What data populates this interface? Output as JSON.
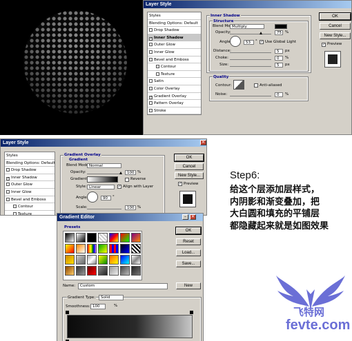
{
  "w1": {
    "title": "Layer Style",
    "styles": [
      {
        "label": "Styles",
        "cb": false,
        "checked": false,
        "sel": false,
        "ind": false
      },
      {
        "label": "Blending Options: Default",
        "cb": false,
        "checked": false,
        "sel": false,
        "ind": false
      },
      {
        "label": "Drop Shadow",
        "cb": true,
        "checked": false,
        "sel": false,
        "ind": false
      },
      {
        "label": "Inner Shadow",
        "cb": true,
        "checked": true,
        "sel": true,
        "ind": false
      },
      {
        "label": "Outer Glow",
        "cb": true,
        "checked": false,
        "sel": false,
        "ind": false
      },
      {
        "label": "Inner Glow",
        "cb": true,
        "checked": false,
        "sel": false,
        "ind": false
      },
      {
        "label": "Bevel and Emboss",
        "cb": true,
        "checked": false,
        "sel": false,
        "ind": false
      },
      {
        "label": "Contour",
        "cb": true,
        "checked": false,
        "sel": false,
        "ind": true
      },
      {
        "label": "Texture",
        "cb": true,
        "checked": false,
        "sel": false,
        "ind": true
      },
      {
        "label": "Satin",
        "cb": true,
        "checked": false,
        "sel": false,
        "ind": false
      },
      {
        "label": "Color Overlay",
        "cb": true,
        "checked": false,
        "sel": false,
        "ind": false
      },
      {
        "label": "Gradient Overlay",
        "cb": true,
        "checked": true,
        "sel": false,
        "ind": false
      },
      {
        "label": "Pattern Overlay",
        "cb": true,
        "checked": false,
        "sel": false,
        "ind": false
      },
      {
        "label": "Stroke",
        "cb": true,
        "checked": false,
        "sel": false,
        "ind": false
      }
    ],
    "group_title": "Inner Shadow",
    "structure": "Structure",
    "blend_label": "Blend Mode:",
    "blend_value": "Multiply",
    "opacity_label": "Opacity:",
    "opacity_value": "75",
    "angle_label": "Angle:",
    "angle_value": "53",
    "global_light": "Use Global Light",
    "distance_label": "Distance:",
    "distance_value": "5",
    "choke_label": "Choke:",
    "choke_value": "0",
    "size_label": "Size:",
    "size_value": "5",
    "quality": "Quality",
    "contour_label": "Contour:",
    "antialiased": "Anti-aliased",
    "noise_label": "Noise:",
    "noise_value": "0",
    "pct": "%",
    "px": "px",
    "deg": "°",
    "ok": "OK",
    "cancel": "Cancel",
    "new_style": "New Style...",
    "preview": "Preview"
  },
  "w2": {
    "title": "Layer Style",
    "styles": [
      {
        "label": "Styles",
        "cb": false,
        "checked": false,
        "sel": false,
        "ind": false
      },
      {
        "label": "Blending Options: Default",
        "cb": false,
        "checked": false,
        "sel": false,
        "ind": false
      },
      {
        "label": "Drop Shadow",
        "cb": true,
        "checked": false,
        "sel": false,
        "ind": false
      },
      {
        "label": "Inner Shadow",
        "cb": true,
        "checked": true,
        "sel": false,
        "ind": false
      },
      {
        "label": "Outer Glow",
        "cb": true,
        "checked": false,
        "sel": false,
        "ind": false
      },
      {
        "label": "Inner Glow",
        "cb": true,
        "checked": false,
        "sel": false,
        "ind": false
      },
      {
        "label": "Bevel and Emboss",
        "cb": true,
        "checked": false,
        "sel": false,
        "ind": false
      },
      {
        "label": "Contour",
        "cb": true,
        "checked": false,
        "sel": false,
        "ind": true
      },
      {
        "label": "Texture",
        "cb": true,
        "checked": false,
        "sel": false,
        "ind": true
      },
      {
        "label": "Satin",
        "cb": true,
        "checked": false,
        "sel": false,
        "ind": false
      },
      {
        "label": "Color Overlay",
        "cb": true,
        "checked": false,
        "sel": false,
        "ind": false
      },
      {
        "label": "Gradient Overlay",
        "cb": true,
        "checked": true,
        "sel": true,
        "ind": false
      },
      {
        "label": "Pattern Overlay",
        "cb": true,
        "checked": false,
        "sel": false,
        "ind": false
      },
      {
        "label": "Stroke",
        "cb": true,
        "checked": false,
        "sel": false,
        "ind": false
      }
    ],
    "group_title": "Gradient Overlay",
    "sub": "Gradient",
    "blend_label": "Blend Mode:",
    "blend_value": "Normal",
    "opacity_label": "Opacity:",
    "opacity_value": "100",
    "gradient_label": "Gradient:",
    "reverse": "Reverse",
    "style_label": "Style:",
    "style_value": "Linear",
    "align": "Align with Layer",
    "angle_label": "Angle:",
    "angle_value": "90",
    "scale_label": "Scale:",
    "scale_value": "100",
    "pct": "%",
    "deg": "°",
    "ok": "OK",
    "cancel": "Cancel",
    "new_style": "New Style...",
    "preview": "Preview"
  },
  "ge": {
    "title": "Gradient Editor",
    "presets": "Presets",
    "ok": "OK",
    "reset": "Reset",
    "load": "Load...",
    "save": "Save...",
    "name_label": "Name:",
    "name_value": "Custom",
    "new": "New",
    "type_label": "Gradient Type:",
    "type_value": "Solid",
    "smooth_label": "Smoothness:",
    "smooth_value": "100",
    "pct": "%"
  },
  "step": {
    "title": "Step6:",
    "lines": [
      "给这个层添加层样式，",
      "内阴影和渐变叠加，把",
      "大白圆和填充的平铺层",
      "都隐藏起来就是如图效果"
    ]
  },
  "logo": {
    "cn": "飞特网",
    "en": "fevte.com"
  }
}
